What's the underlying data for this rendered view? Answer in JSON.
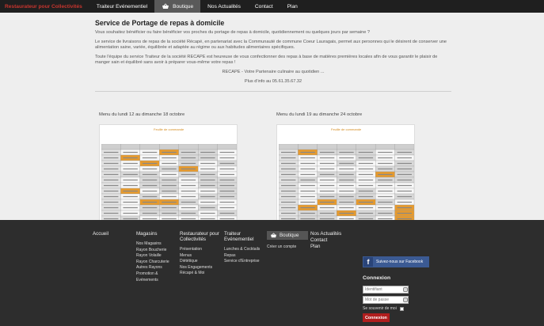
{
  "nav": {
    "brand": "Restaurateur pour Collectivités",
    "items": [
      "Traiteur Evénementiel",
      "Boutique",
      "Nos Actualités",
      "Contact",
      "Plan"
    ]
  },
  "content": {
    "title": "Service de Portage de repas à domicile",
    "p1": "Vous souhaitez bénéficier ou faire bénéficier vos proches du portage de repas à domicile, quotidiennement ou quelques jours par semaine ?",
    "p2": "Le service de livraisons de repas de la société Récapé, en partenariat avec la Communauté de commune Coeur Lauragais, permet aux personnes qui le désirent de conserver une alimentation saine, variée, équilibrée et adaptée au régime ou aux habitudes alimentaires spécifiques.",
    "p3": "Toute l'équipe du service Traiteur de la société RECAPE est heureuse de vous confectionner des repas à base de matières premières locales afin de vous garantir le plaisir de manger sain et équilibré sans avoir à préparer vous-même votre repas !",
    "p4": "RECAPE - Votre Partenaire culinaire au quotidien ...",
    "p5": "Plus d'info au 05.61.35.67.32"
  },
  "menus": [
    {
      "caption": "Menu du lundi 12 au dimanche 18 octobre",
      "sheet_title": "Feuille de commande"
    },
    {
      "caption": "Menu du lundi 19 au dimanche 24 octobre",
      "sheet_title": "Feuille de commande"
    }
  ],
  "footer": {
    "accueil": "Accueil",
    "magasins": {
      "title": "Magasins",
      "links": [
        "Nos Magasins",
        "Rayon Boucherie",
        "Rayon Volaille",
        "Rayon Charcuterie",
        "Autres Rayons",
        "Promotion & Evénements"
      ]
    },
    "restaurateur": {
      "title": "Restaurateur pour Collectivités",
      "links": [
        "Présentation",
        "Menus",
        "Diététique",
        "Nos Engagements",
        "Récapé & Moi"
      ]
    },
    "traiteur": {
      "title": "Traiteur Evénementiel",
      "links": [
        "Lunches & Cocktails",
        "Repas",
        "Service d'Entreprise"
      ]
    },
    "boutique": {
      "title": "Boutique",
      "links": [
        "Créer un compte"
      ]
    },
    "other": [
      "Nos Actualités",
      "Contact",
      "Plan"
    ],
    "facebook": "Suivez-nous sur Facebook",
    "login": {
      "title": "Connexion",
      "id_placeholder": "Identifiant",
      "pw_placeholder": "Mot de passe",
      "remember": "Se souvenir de moi",
      "button": "Connexion"
    }
  },
  "colors": {
    "brand_red": "#c8352e",
    "facebook_blue": "#3b5a93",
    "button_red": "#b01e1e"
  }
}
